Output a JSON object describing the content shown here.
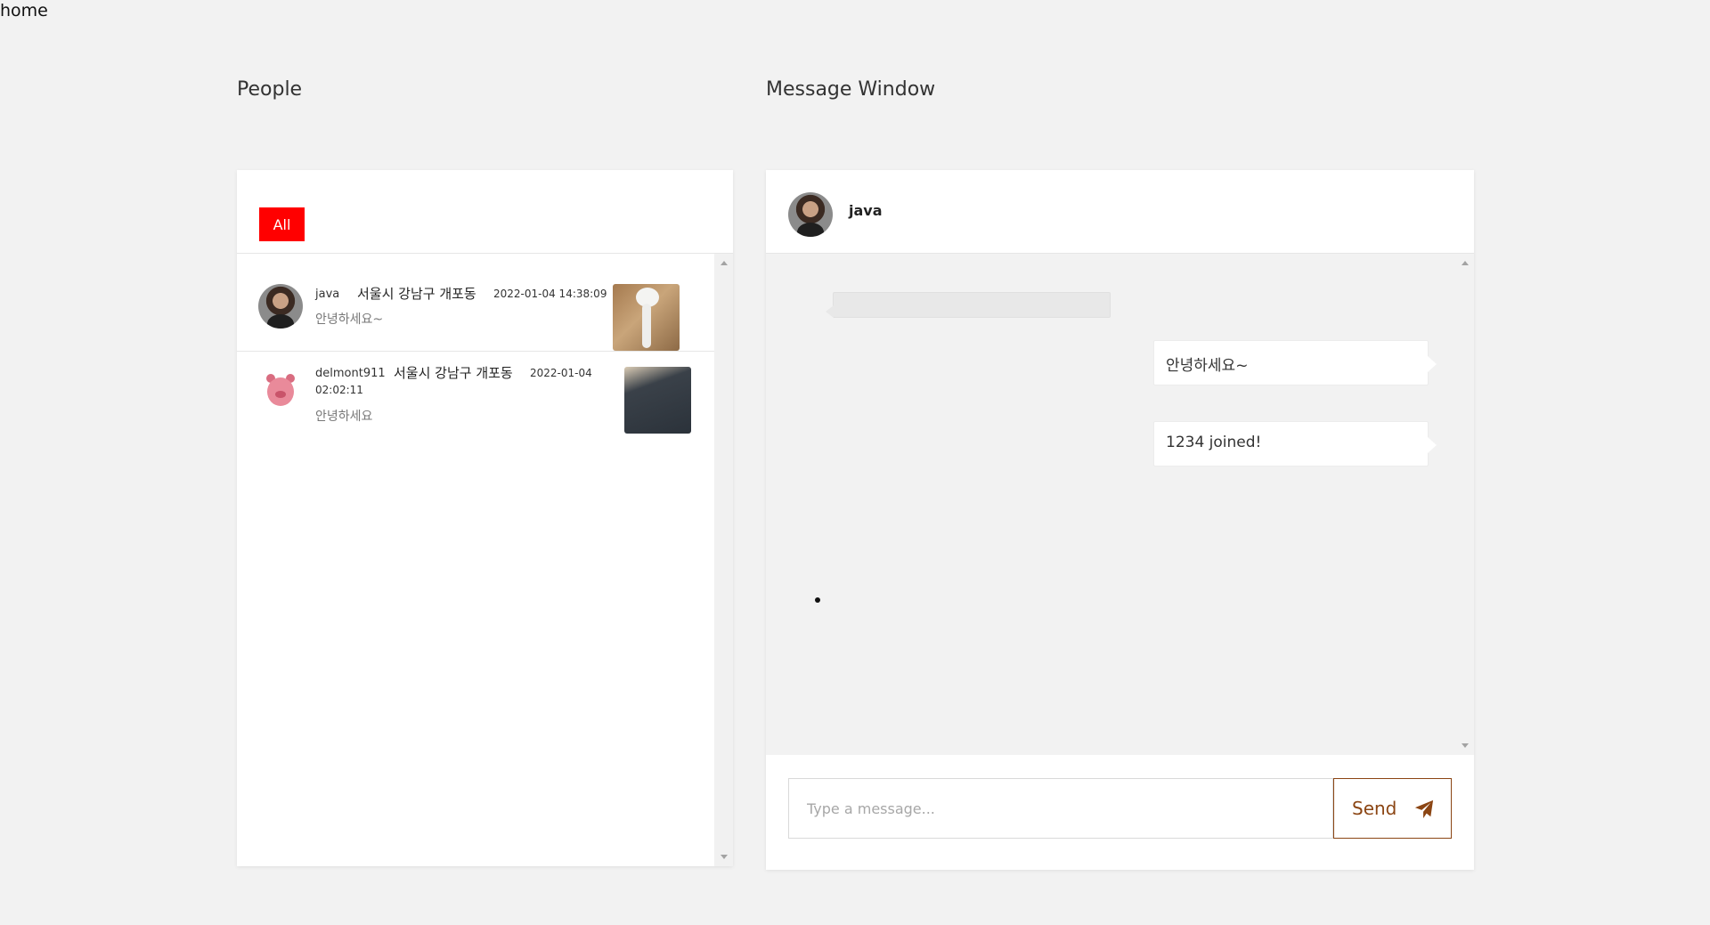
{
  "nav": {
    "home_label": "home"
  },
  "people": {
    "heading": "People",
    "filter_label": "All",
    "items": [
      {
        "name": "java",
        "location": "서울시 강남구 개포동",
        "time": "2022-01-04 14:38:09",
        "message": "안녕하세요~",
        "avatar": "person-avatar",
        "thumbnail": "airpod-photo"
      },
      {
        "name": "delmont911",
        "location": "서울시 강남구 개포동",
        "time_date": "2022-01-04",
        "time_clock": "02:02:11",
        "message": "안녕하세요",
        "avatar": "pink-pig-avatar",
        "thumbnail": "dark-item-photo"
      }
    ]
  },
  "message_window": {
    "heading": "Message Window",
    "partner_name": "java",
    "messages": [
      {
        "direction": "incoming",
        "text": ""
      },
      {
        "direction": "outgoing",
        "text": "안녕하세요~"
      },
      {
        "direction": "outgoing",
        "text": "1234 joined!"
      }
    ],
    "input_placeholder": "Type a message...",
    "send_label": "Send",
    "send_icon": "paper-plane-icon",
    "accent_color": "#8b4513"
  },
  "colors": {
    "filter_active": "#ff0000",
    "background": "#f2f2f2"
  }
}
